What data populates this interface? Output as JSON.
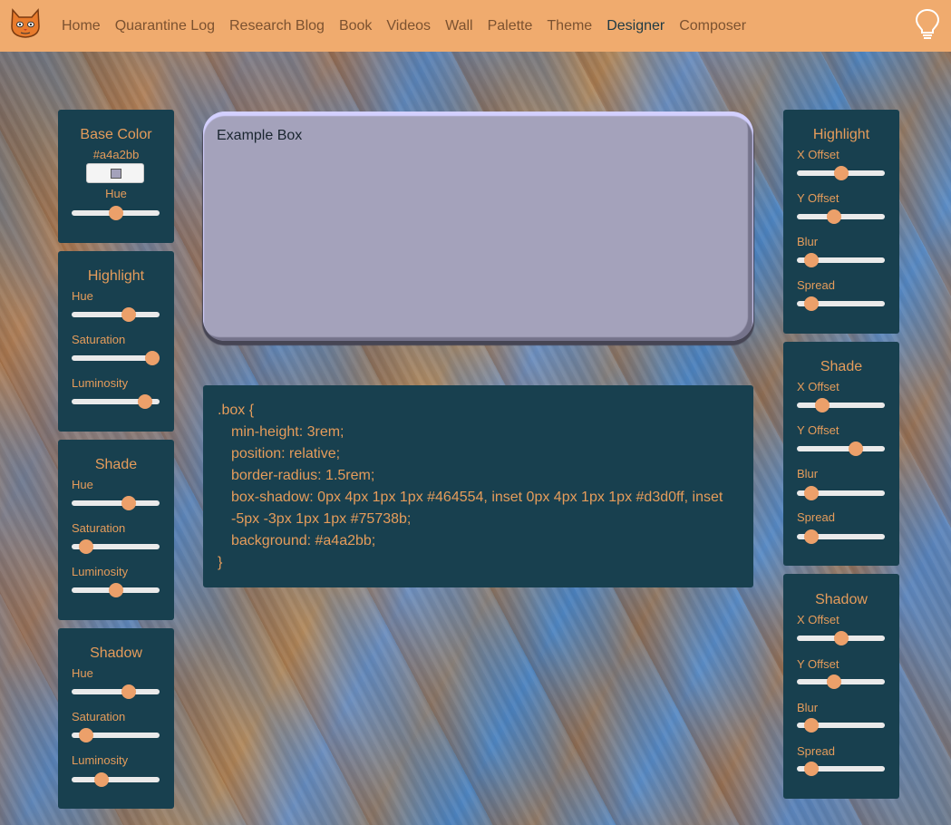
{
  "nav": {
    "items": [
      "Home",
      "Quarantine Log",
      "Research Blog",
      "Book",
      "Videos",
      "Wall",
      "Palette",
      "Theme",
      "Designer",
      "Composer"
    ],
    "active": "Designer",
    "logo_icon": "cat-icon",
    "right_icon": "lightbulb-icon"
  },
  "base_color": {
    "title": "Base Color",
    "hex": "#a4a2bb",
    "hue_label": "Hue",
    "hue_value": 0.5
  },
  "left_highlight": {
    "title": "Highlight",
    "sliders": [
      {
        "label": "Hue",
        "value": 0.65
      },
      {
        "label": "Saturation",
        "value": 0.92
      },
      {
        "label": "Luminosity",
        "value": 0.83
      }
    ]
  },
  "left_shade": {
    "title": "Shade",
    "sliders": [
      {
        "label": "Hue",
        "value": 0.65
      },
      {
        "label": "Saturation",
        "value": 0.17
      },
      {
        "label": "Luminosity",
        "value": 0.5
      }
    ]
  },
  "left_shadow": {
    "title": "Shadow",
    "sliders": [
      {
        "label": "Hue",
        "value": 0.65
      },
      {
        "label": "Saturation",
        "value": 0.17
      },
      {
        "label": "Luminosity",
        "value": 0.34
      }
    ]
  },
  "example_box": {
    "label": "Example Box",
    "background": "#a4a2bb"
  },
  "code": {
    "line1": ".box {",
    "line2": "min-height: 3rem;",
    "line3": "position: relative;",
    "line4": "border-radius: 1.5rem;",
    "line5": "box-shadow: 0px 4px 1px 1px #464554, inset 0px 4px 1px 1px #d3d0ff, inset",
    "line6": "-5px -3px 1px 1px #75738b;",
    "line7": "background: #a4a2bb;",
    "line8": "}"
  },
  "right_highlight": {
    "title": "Highlight",
    "sliders": [
      {
        "label": "X Offset",
        "value": 0.5
      },
      {
        "label": "Y Offset",
        "value": 0.42
      },
      {
        "label": "Blur",
        "value": 0.17
      },
      {
        "label": "Spread",
        "value": 0.17
      }
    ]
  },
  "right_shade": {
    "title": "Shade",
    "sliders": [
      {
        "label": "X Offset",
        "value": 0.29
      },
      {
        "label": "Y Offset",
        "value": 0.67
      },
      {
        "label": "Blur",
        "value": 0.17
      },
      {
        "label": "Spread",
        "value": 0.17
      }
    ]
  },
  "right_shadow": {
    "title": "Shadow",
    "sliders": [
      {
        "label": "X Offset",
        "value": 0.5
      },
      {
        "label": "Y Offset",
        "value": 0.42
      },
      {
        "label": "Blur",
        "value": 0.17
      },
      {
        "label": "Spread",
        "value": 0.17
      }
    ]
  },
  "colors": {
    "nav_bg": "#f0ab6e",
    "panel_bg": "#18404f",
    "accent": "#e59c5b"
  }
}
